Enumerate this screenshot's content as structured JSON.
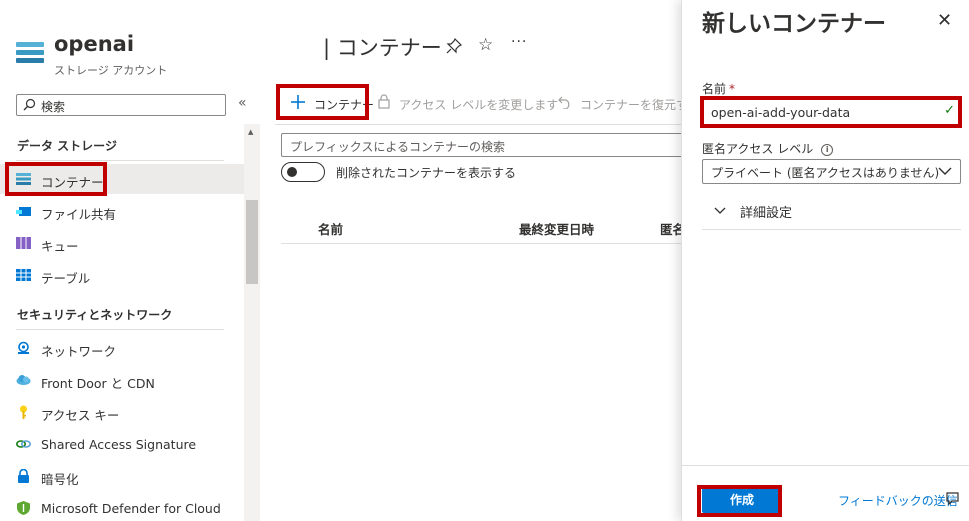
{
  "resource": {
    "name": "openai",
    "type": "ストレージ アカウント"
  },
  "search": {
    "placeholder": "検索"
  },
  "sidebar": {
    "sections": [
      {
        "label": "データ ストレージ"
      },
      {
        "label": "セキュリティとネットワーク"
      }
    ],
    "items": [
      {
        "label": "コンテナー",
        "icon": "container-icon",
        "selected": true
      },
      {
        "label": "ファイル共有",
        "icon": "file-share-icon"
      },
      {
        "label": "キュー",
        "icon": "queue-icon"
      },
      {
        "label": "テーブル",
        "icon": "table-icon"
      },
      {
        "label": "ネットワーク",
        "icon": "network-icon"
      },
      {
        "label": "Front Door と CDN",
        "icon": "cloud-icon"
      },
      {
        "label": "アクセス キー",
        "icon": "key-icon"
      },
      {
        "label": "Shared Access Signature",
        "icon": "link-icon"
      },
      {
        "label": "暗号化",
        "icon": "lock-icon"
      },
      {
        "label": "Microsoft Defender for Cloud",
        "icon": "shield-icon"
      }
    ]
  },
  "main": {
    "title": "| コンテナー",
    "toolbar": {
      "add_label": "コンテナー",
      "access_label": "アクセス レベルを変更します",
      "restore_label": "コンテナーを復元す"
    },
    "filter": {
      "placeholder": "プレフィックスによるコンテナーの検索"
    },
    "toggle": {
      "label": "削除されたコンテナーを表示する"
    },
    "table": {
      "headers": [
        "名前",
        "最終変更日時",
        "匿名"
      ]
    }
  },
  "panel": {
    "title": "新しいコンテナー",
    "name_label": "名前",
    "required_mark": "*",
    "name_value": "open-ai-add-your-data",
    "access_label": "匿名アクセス レベル",
    "info_glyph": "i",
    "access_value": "プライベート (匿名アクセスはありません)",
    "advanced_label": "詳細設定",
    "create_label": "作成",
    "feedback_label": "フィードバックの送信"
  },
  "colors": {
    "accent": "#0078d4",
    "highlight": "#c00000",
    "success": "#107c10"
  }
}
